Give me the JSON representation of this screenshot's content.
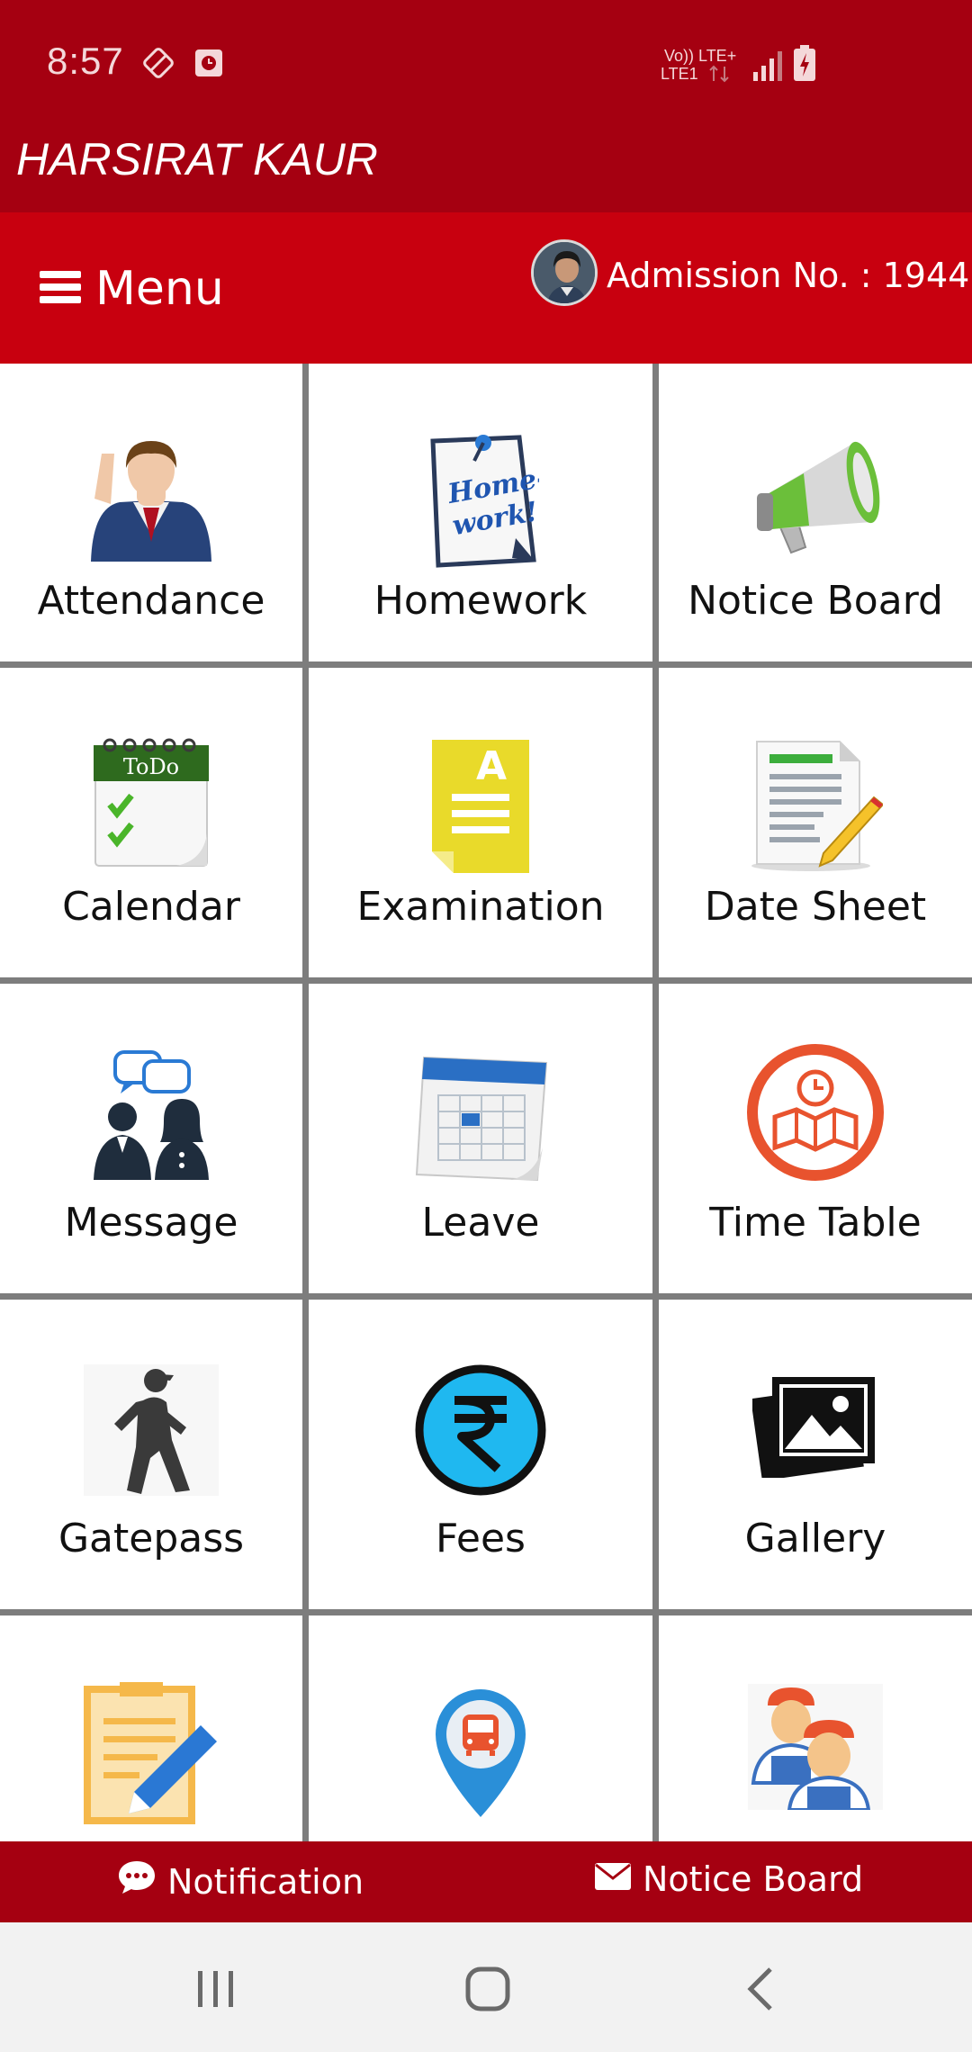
{
  "status_bar": {
    "time": "8:57",
    "network_label_top": "Vo)) LTE+",
    "network_label_bottom": "LTE1"
  },
  "app": {
    "title": "HARSIRAT KAUR",
    "brand_color": "#c8000f",
    "dark_color": "#a50011"
  },
  "menu_bar": {
    "menu_label": "Menu",
    "admission": "Admission No. : 1944"
  },
  "tiles": [
    {
      "label": "Attendance",
      "icon": "student-icon"
    },
    {
      "label": "Homework",
      "icon": "homework-note-icon"
    },
    {
      "label": "Notice Board",
      "icon": "megaphone-icon"
    },
    {
      "label": "Calendar",
      "icon": "todo-calendar-icon"
    },
    {
      "label": "Examination",
      "icon": "exam-paper-icon"
    },
    {
      "label": "Date Sheet",
      "icon": "document-pencil-icon"
    },
    {
      "label": "Message",
      "icon": "chat-people-icon"
    },
    {
      "label": "Leave",
      "icon": "leave-calendar-icon"
    },
    {
      "label": "Time Table",
      "icon": "clock-map-icon"
    },
    {
      "label": "Gatepass",
      "icon": "walking-person-icon"
    },
    {
      "label": "Fees",
      "icon": "rupee-icon"
    },
    {
      "label": "Gallery",
      "icon": "photos-icon"
    },
    {
      "label": "",
      "icon": "notes-edit-icon"
    },
    {
      "label": "",
      "icon": "bus-location-icon"
    },
    {
      "label": "",
      "icon": "staff-icon"
    }
  ],
  "bottom_bar": {
    "notification_label": "Notification",
    "notice_board_label": "Notice Board"
  }
}
